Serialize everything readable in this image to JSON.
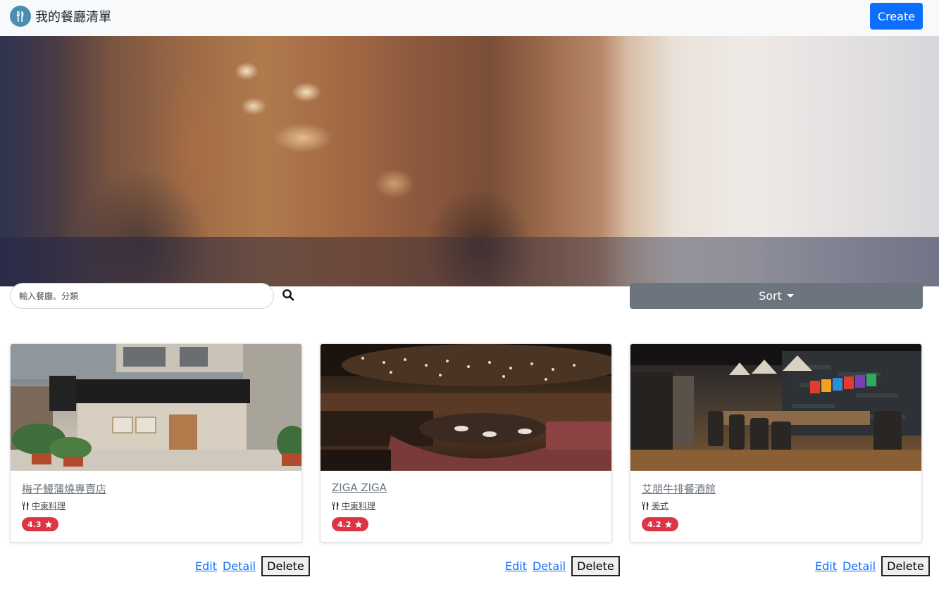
{
  "navbar": {
    "brand_title": "我的餐廳清單",
    "create_label": "Create"
  },
  "search": {
    "placeholder": "輸入餐廳、分類"
  },
  "sort": {
    "label": "Sort"
  },
  "restaurants": [
    {
      "name": "梅子鰻蒲燒專賣店",
      "category": "中東料理",
      "rating": "4.3"
    },
    {
      "name": "ZIGA ZIGA",
      "category": "中東料理",
      "rating": "4.2"
    },
    {
      "name": "艾朋牛排餐酒館",
      "category": "美式",
      "rating": "4.2"
    }
  ],
  "card_actions": {
    "edit": "Edit",
    "detail": "Detail",
    "delete": "Delete"
  },
  "colors": {
    "primary": "#0d6efd",
    "secondary": "#6c757d",
    "danger": "#dc3545"
  },
  "icons": [
    "utensils-logo-icon",
    "search-icon",
    "caret-down-icon",
    "utensils-icon",
    "star-icon"
  ]
}
